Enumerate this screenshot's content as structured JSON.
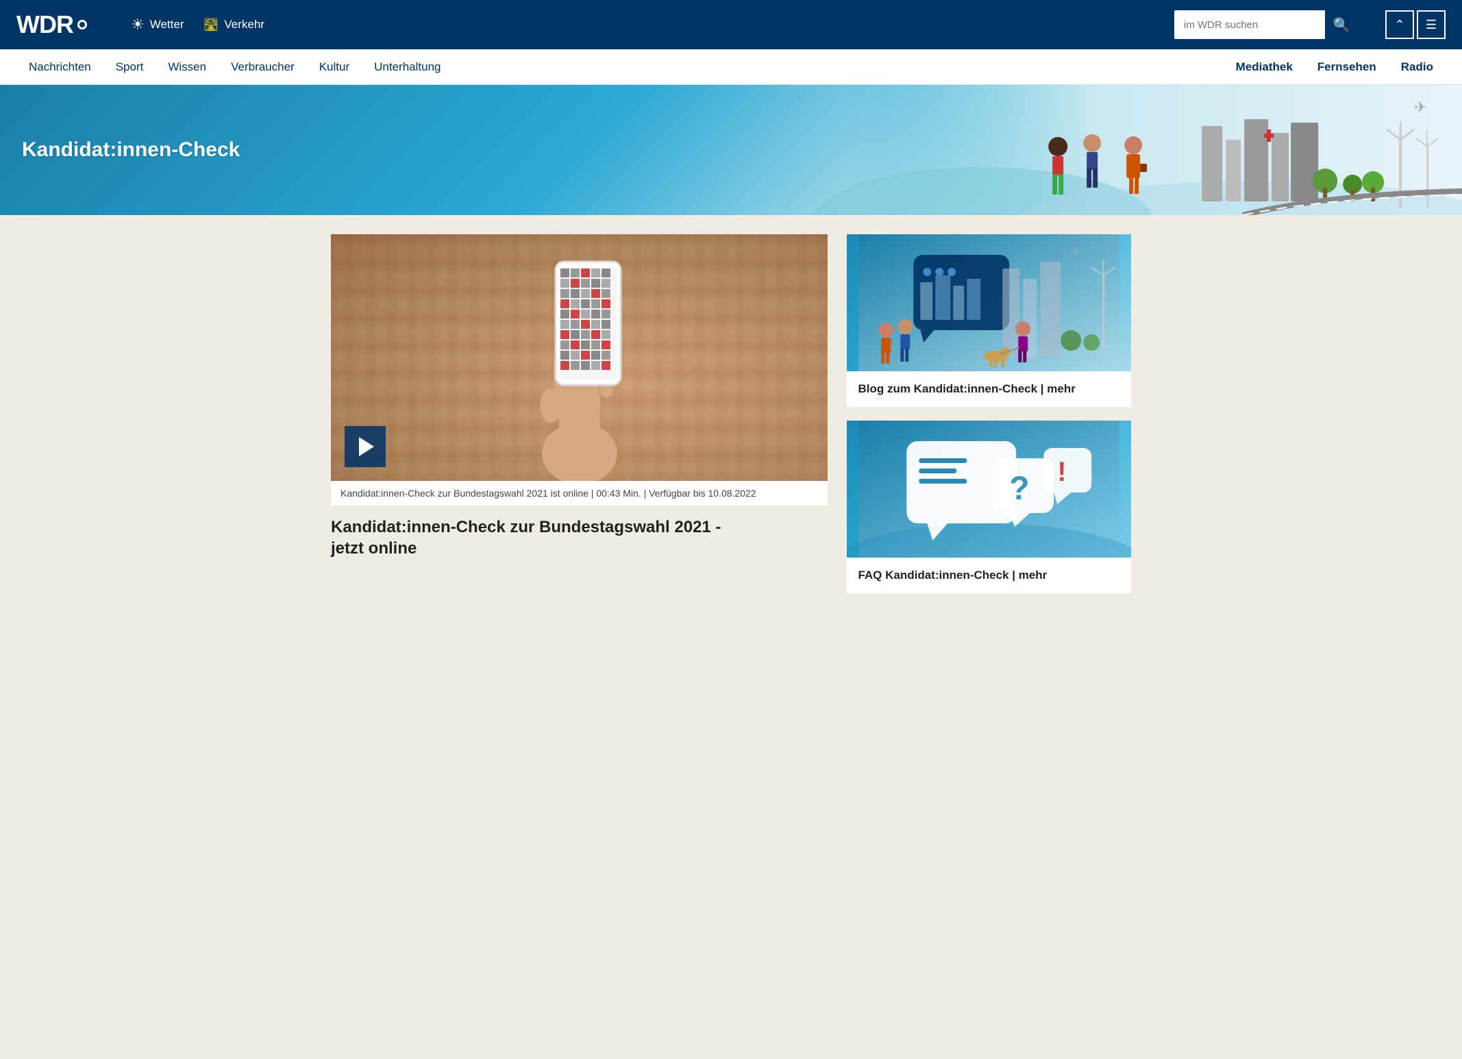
{
  "header": {
    "logo": "WDR",
    "weather_label": "Wetter",
    "traffic_label": "Verkehr",
    "search_placeholder": "im WDR suchen",
    "nav_items": [
      {
        "label": "Nachrichten",
        "bold": false
      },
      {
        "label": "Sport",
        "bold": false
      },
      {
        "label": "Wissen",
        "bold": false
      },
      {
        "label": "Verbraucher",
        "bold": false
      },
      {
        "label": "Kultur",
        "bold": false
      },
      {
        "label": "Unterhaltung",
        "bold": false
      },
      {
        "label": "Mediathek",
        "bold": true
      },
      {
        "label": "Fernsehen",
        "bold": true
      },
      {
        "label": "Radio",
        "bold": true
      }
    ]
  },
  "hero": {
    "title": "Kandidat:innen-Check"
  },
  "main": {
    "video": {
      "meta": "Kandidat:innen-Check zur Bundestagswahl 2021 ist online | 00:43 Min. | Verfügbar bis 10.08.2022",
      "headline_line1": "Kandidat:innen-Check zur Bundestagswahl 2021 -",
      "headline_line2": "jetzt online"
    },
    "sidebar_cards": [
      {
        "title": "Blog zum Kandidat:innen-Check | mehr",
        "type": "illustration"
      },
      {
        "title": "FAQ Kandidat:innen-Check | mehr",
        "type": "faq"
      }
    ]
  }
}
